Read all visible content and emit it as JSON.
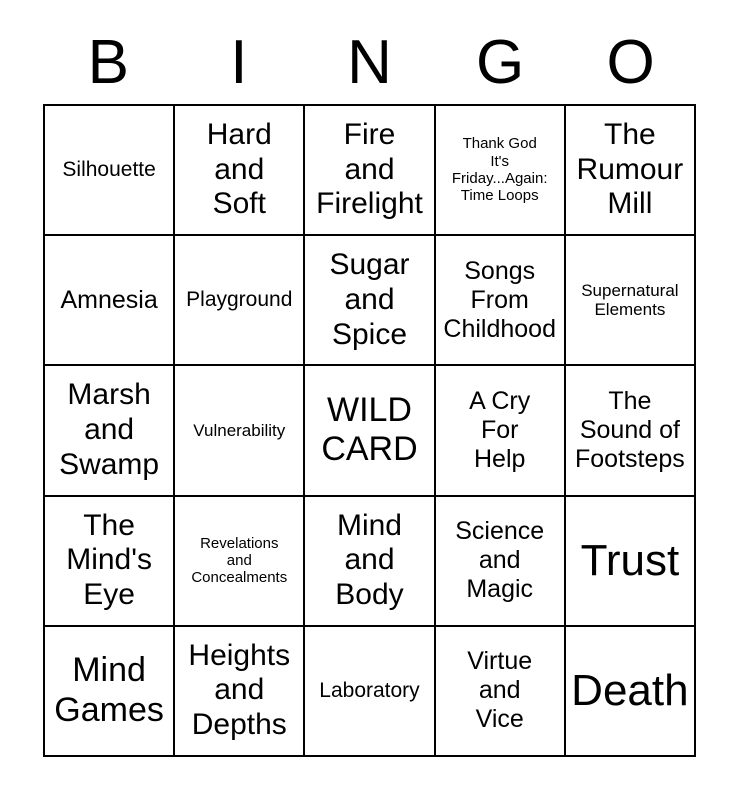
{
  "header": {
    "letters": [
      "B",
      "I",
      "N",
      "G",
      "O"
    ]
  },
  "grid": {
    "columns": 5,
    "rows": 5,
    "cells": [
      {
        "text": "Silhouette",
        "size": "sm"
      },
      {
        "text": "Hard\nand\nSoft",
        "size": "lg"
      },
      {
        "text": "Fire\nand\nFirelight",
        "size": "lg"
      },
      {
        "text": "Thank God\nIt's\nFriday...Again:\nTime Loops",
        "size": "xxs"
      },
      {
        "text": "The\nRumour\nMill",
        "size": "lg"
      },
      {
        "text": "Amnesia",
        "size": "md"
      },
      {
        "text": "Playground",
        "size": "sm"
      },
      {
        "text": "Sugar\nand\nSpice",
        "size": "lg"
      },
      {
        "text": "Songs\nFrom\nChildhood",
        "size": "md"
      },
      {
        "text": "Supernatural\nElements",
        "size": "xs"
      },
      {
        "text": "Marsh\nand\nSwamp",
        "size": "lg"
      },
      {
        "text": "Vulnerability",
        "size": "xs"
      },
      {
        "text": "WILD\nCARD",
        "size": "xl"
      },
      {
        "text": "A Cry\nFor\nHelp",
        "size": "md"
      },
      {
        "text": "The\nSound of\nFootsteps",
        "size": "md"
      },
      {
        "text": "The\nMind's\nEye",
        "size": "lg"
      },
      {
        "text": "Revelations\nand\nConcealments",
        "size": "xxs"
      },
      {
        "text": "Mind\nand\nBody",
        "size": "lg"
      },
      {
        "text": "Science\nand\nMagic",
        "size": "md"
      },
      {
        "text": "Trust",
        "size": "xxl"
      },
      {
        "text": "Mind\nGames",
        "size": "xl"
      },
      {
        "text": "Heights\nand\nDepths",
        "size": "lg"
      },
      {
        "text": "Laboratory",
        "size": "sm"
      },
      {
        "text": "Virtue\nand\nVice",
        "size": "md"
      },
      {
        "text": "Death",
        "size": "xxl"
      }
    ]
  },
  "colors": {
    "background": "#ffffff",
    "text": "#000000",
    "border": "#000000"
  }
}
